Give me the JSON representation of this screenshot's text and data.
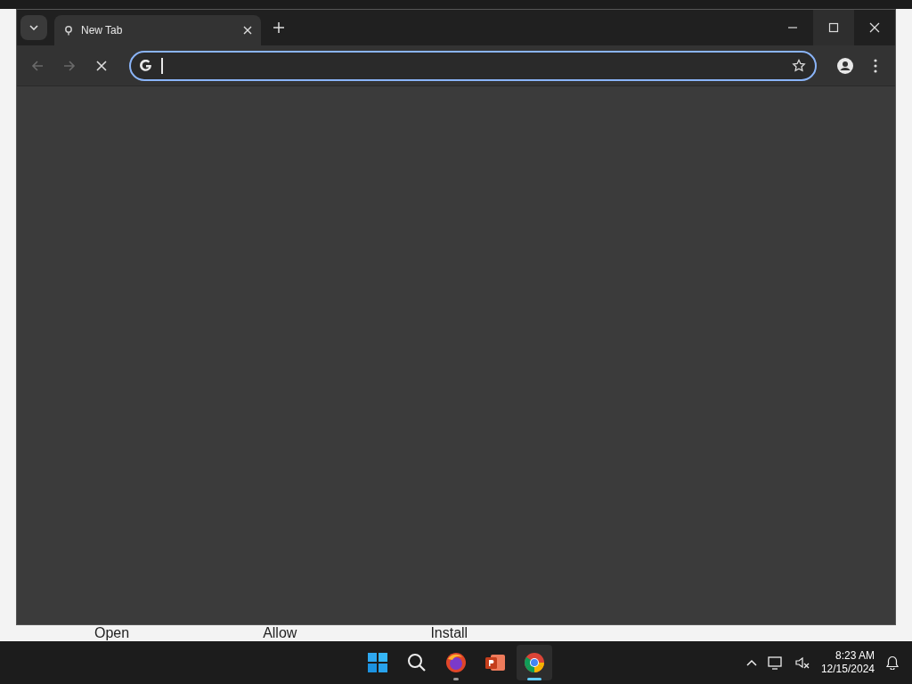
{
  "background_page": {
    "buttons": [
      "Open",
      "Allow",
      "Install"
    ]
  },
  "browser": {
    "tabs": [
      {
        "title": "New Tab",
        "selected": true
      }
    ],
    "navigation": {
      "back_disabled": true,
      "forward_disabled": true,
      "loading": true
    },
    "address_bar": {
      "focused": true
    }
  },
  "taskbar": {
    "apps": [
      {
        "kind": "start",
        "running": false,
        "selected": false
      },
      {
        "kind": "search",
        "running": false,
        "selected": false
      },
      {
        "kind": "firefox",
        "running": true,
        "selected": false
      },
      {
        "kind": "powerpoint",
        "running": false,
        "selected": false
      },
      {
        "kind": "chrome",
        "running": true,
        "selected": true
      }
    ],
    "time": "8:23 AM",
    "date": "12/15/2024"
  }
}
